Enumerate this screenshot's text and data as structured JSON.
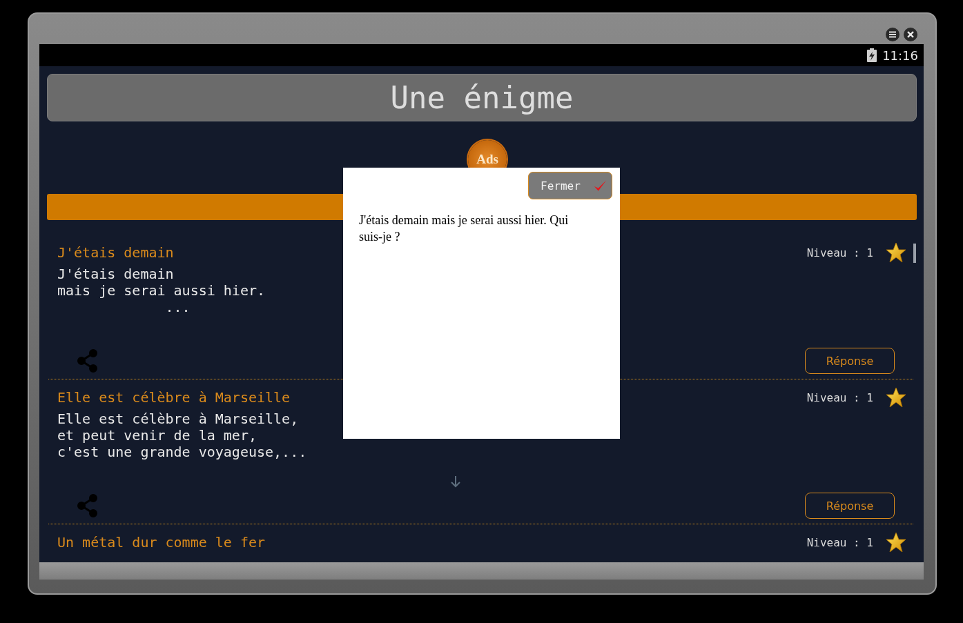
{
  "status_bar": {
    "time": "11:16"
  },
  "header": {
    "title": "Une énigme"
  },
  "ad": {
    "label": "Ads"
  },
  "riddles": [
    {
      "title": "J'étais demain",
      "level_label": "Niveau : 1",
      "lines": [
        "J'étais demain",
        "mais je serai aussi hier.",
        "             ..."
      ],
      "answer_button": "Réponse"
    },
    {
      "title": "Elle est célèbre à Marseille",
      "level_label": "Niveau : 1",
      "lines": [
        "Elle est célèbre à Marseille,",
        "et peut venir de la mer,",
        "c'est une grande voyageuse,..."
      ],
      "answer_button": "Réponse"
    },
    {
      "title": "Un métal dur comme le fer",
      "level_label": "Niveau : 1"
    }
  ],
  "dialog": {
    "close_button": "Fermer",
    "text": "J'étais demain mais je serai aussi hier. Qui suis-je ?"
  }
}
